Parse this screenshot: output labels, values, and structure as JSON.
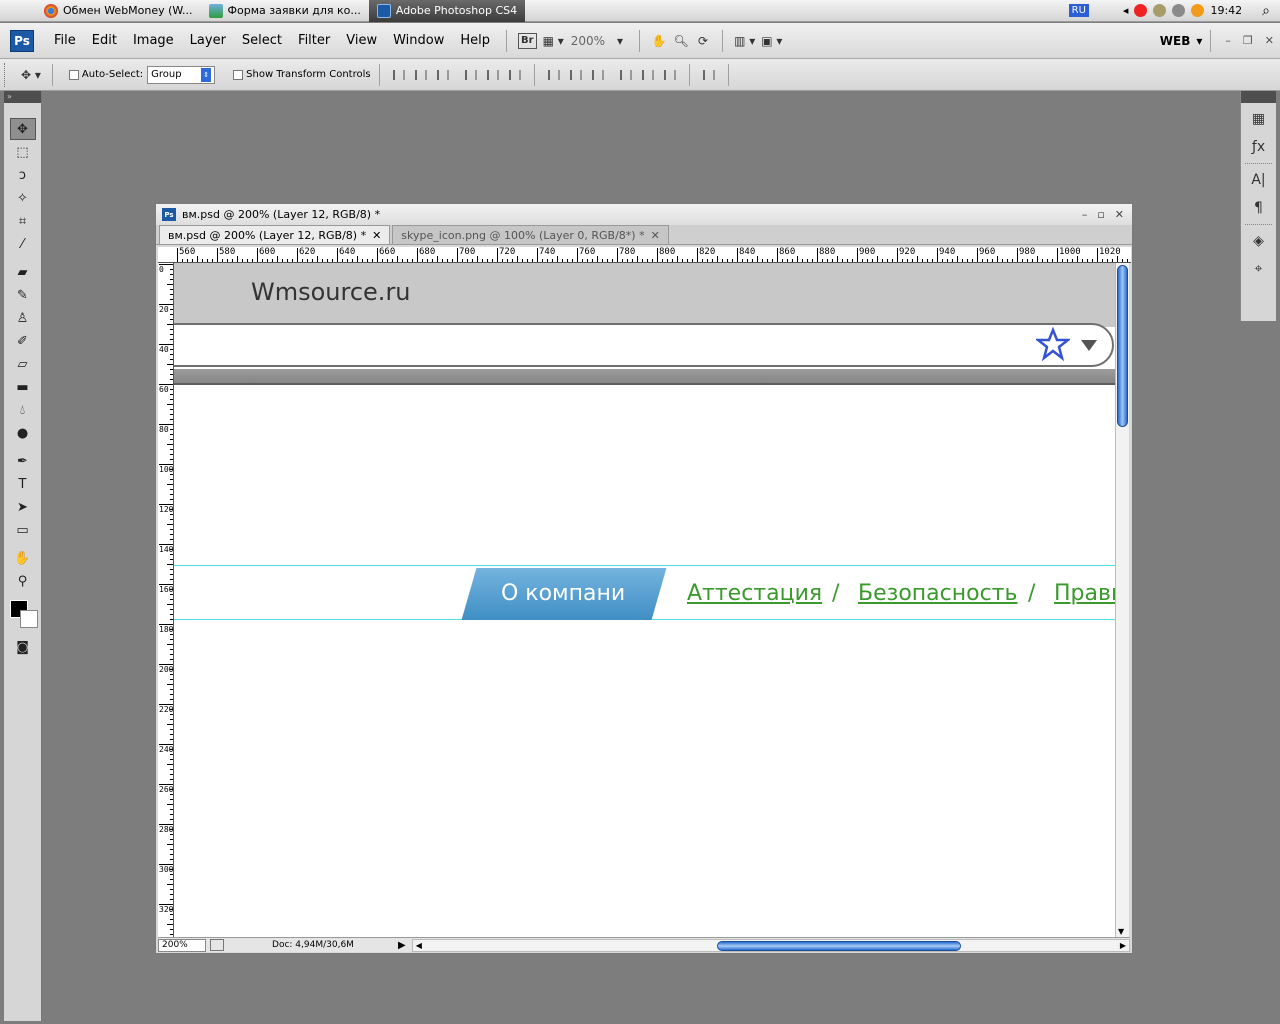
{
  "os_bar": {
    "tabs": [
      {
        "label": "Обмен WebMoney (W...",
        "color": "#e8a020"
      },
      {
        "label": "Форма заявки для ко...",
        "color": "#2e9d3a"
      },
      {
        "label": "Adobe Photoshop CS4",
        "color": "#1c5aa6"
      }
    ],
    "lang": "RU",
    "time": "19:42"
  },
  "app": {
    "logo": "Ps",
    "menu": [
      "File",
      "Edit",
      "Image",
      "Layer",
      "Select",
      "Filter",
      "View",
      "Window",
      "Help"
    ],
    "bridge_label": "Br",
    "zoom": "200%",
    "workspace": "WEB"
  },
  "options": {
    "auto_select_label": "Auto-Select:",
    "auto_select_value": "Group",
    "transform_label": "Show Transform Controls"
  },
  "document": {
    "title": "вм.psd @ 200% (Layer 12, RGB/8) *",
    "tabs": [
      {
        "label": "вм.psd @ 200% (Layer 12, RGB/8) *",
        "active": true
      },
      {
        "label": "skype_icon.png @ 100% (Layer 0, RGB/8*) *",
        "active": false
      }
    ],
    "ruler_top": [
      "560",
      "580",
      "600",
      "620",
      "640",
      "660",
      "680",
      "700",
      "720",
      "740",
      "760",
      "780",
      "800",
      "820",
      "840",
      "860",
      "880",
      "900",
      "920",
      "940",
      "960",
      "980",
      "1000",
      "1020"
    ],
    "ruler_left": [
      "0",
      "20",
      "40",
      "60",
      "80",
      "100",
      "120",
      "140",
      "160",
      "180",
      "200",
      "220",
      "240",
      "260",
      "280",
      "300",
      "320"
    ],
    "status_zoom": "200%",
    "status_doc": "Doc: 4,94M/30,6M"
  },
  "site": {
    "title": "Wmsource.ru",
    "nav_active": "О компани",
    "nav_links": [
      "Аттестация",
      "Безопасность",
      "Прави"
    ],
    "separator": "/",
    "colors": {
      "active_tab": "#4f9dd0",
      "link": "#3a9a2c",
      "header": "#c8c8c8",
      "guide": "#4ee0e0"
    }
  }
}
